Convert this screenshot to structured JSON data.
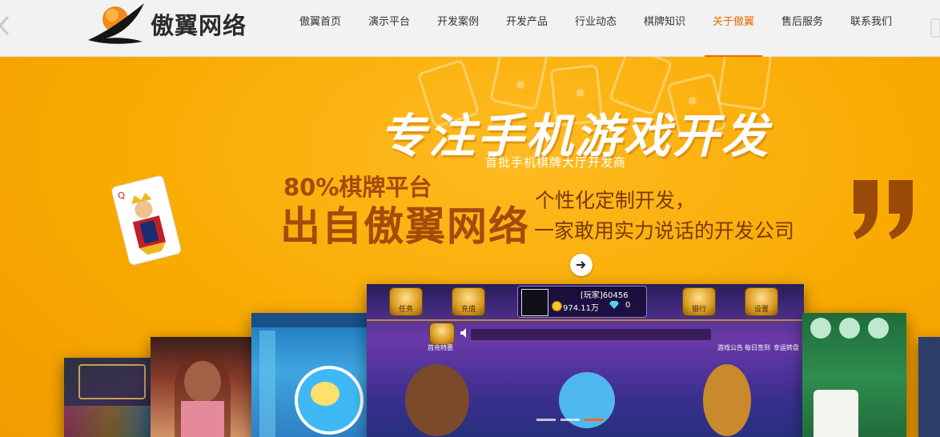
{
  "header": {
    "logo_text": "傲翼网络",
    "nav": [
      {
        "label": "傲翼首页"
      },
      {
        "label": "演示平台"
      },
      {
        "label": "开发案例"
      },
      {
        "label": "开发产品"
      },
      {
        "label": "行业动态"
      },
      {
        "label": "棋牌知识"
      },
      {
        "label": "关于傲翼",
        "active": true
      },
      {
        "label": "售后服务"
      },
      {
        "label": "联系我们"
      }
    ]
  },
  "banner": {
    "headline": "专注手机游戏开发",
    "subline": "首批手机棋牌大厅开发商",
    "percent_line": "80%棋牌平台",
    "big_line": "出自傲翼网络",
    "slogan_1": "个性化定制开发，",
    "slogan_2": "一家敢用实力说话的开发公司"
  },
  "game_screen": {
    "buttons": [
      {
        "label": "任务"
      },
      {
        "label": "充值"
      },
      {
        "label": "银行"
      },
      {
        "label": "设置"
      }
    ],
    "player_name": "[玩家]60456",
    "coins": "974.11万",
    "gems": "0",
    "promo_label": "首充特惠",
    "notice_label": "游戏公告",
    "daily_label": "每日签到",
    "lucky_label": "幸运转盘"
  },
  "colors": {
    "accent": "#e86a00",
    "banner_bg": "#f6a900",
    "banner_text_dark": "#a54a0a"
  },
  "icons": [
    "logo-swoosh-icon",
    "arrow-right-icon",
    "quote-icon",
    "queen-card-icon",
    "speaker-icon"
  ]
}
